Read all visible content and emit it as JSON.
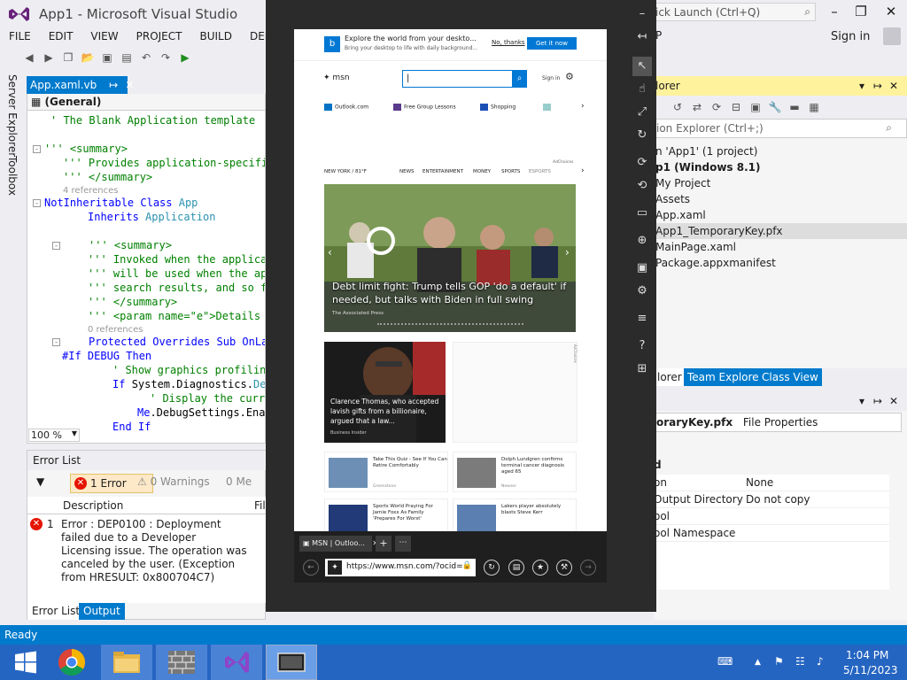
{
  "vs": {
    "title": "App1 - Microsoft Visual Studio",
    "quick_launch": "ick Launch (Ctrl+Q)",
    "sign_in": "Sign in",
    "menu": [
      "FILE",
      "EDIT",
      "VIEW",
      "PROJECT",
      "BUILD",
      "DEBUG"
    ],
    "menu_fragment": "P"
  },
  "side_tabs": [
    "Server Explorer",
    "Toolbox"
  ],
  "editor": {
    "tab_label": "App.xaml.vb",
    "nav": "(General)",
    "zoom": "100 %",
    "lines": [
      "' The Blank Application template",
      "''' <summary>",
      "''' Provides application-specific",
      "''' </summary>",
      "4 references",
      "NotInheritable Class App",
      "Inherits Application",
      "''' <summary>",
      "''' Invoked when the applicat",
      "''' will be used when the app",
      "''' search results, and so fo",
      "''' </summary>",
      "''' <param name=\"e\">Details a",
      "0 references",
      "Protected Overrides Sub OnLau",
      "#If DEBUG Then",
      "' Show graphics profiling",
      "If System.Diagnostics.Deb",
      "' Display the current",
      "Me.DebugSettings.Enab",
      "End If"
    ]
  },
  "error_list": {
    "title": "Error List",
    "errors_btn": "1 Error",
    "warnings_btn": "0 Warnings",
    "messages_btn": "0 Me",
    "col_description": "Description",
    "col_file": "Fil",
    "row_num": "1",
    "row_text": "Error : DEP0100 : Deployment failed due to a Developer Licensing issue. The operation was canceled by the user. (Exception from HRESULT: 0x800704C7)",
    "tab_errors": "Error List",
    "tab_output": "Output"
  },
  "solution": {
    "title": "lorer",
    "search": "ion Explorer (Ctrl+;)",
    "items": [
      "n 'App1' (1 project)",
      "p1 (Windows 8.1)",
      "My Project",
      "Assets",
      "App.xaml",
      "App1_TemporaryKey.pfx",
      "MainPage.xaml",
      "Package.appxmanifest"
    ],
    "tabs": [
      "lorer",
      "Team Explorer",
      "Class View"
    ]
  },
  "properties": {
    "combo_file": "oraryKey.pfx",
    "combo_type": "File Properties",
    "section": "d",
    "rows": [
      {
        "key": "on",
        "value": "None"
      },
      {
        "key": "Output Directory",
        "value": "Do not copy"
      },
      {
        "key": "ool",
        "value": ""
      },
      {
        "key": "ool Namespace",
        "value": ""
      }
    ]
  },
  "status": "Ready",
  "msn": {
    "banner_title": "Explore the world from your deskto...",
    "banner_sub": "Bring your desktop to life with daily background...",
    "not_now": "No, thanks",
    "get_it": "Get it now",
    "logo": "msn",
    "signin": "Sign in",
    "links": [
      "Outlook.com",
      "Free Group Lessons",
      "Shopping"
    ],
    "adchoices": "AdChoices",
    "nav": [
      "NEW YORK / 81°F",
      "NEWS",
      "ENTERTAINMENT",
      "MONEY",
      "SPORTS",
      "ESPORTS"
    ],
    "hero_title": "Debt limit fight: Trump tells GOP 'do a default' if needed, but talks with Biden in full swing",
    "hero_source": "The Associated Press",
    "card1_title": "Clarence Thomas, who accepted lavish gifts from a billionaire, argued that a law...",
    "card1_source": "Business Insider",
    "ad_label": "AdChoices",
    "small": [
      {
        "title": "Take This Quiz - See If You Can Retire Comfortably",
        "source": "Greenstone"
      },
      {
        "title": "Dolph Lundgren confirms terminal cancer diagnosis aged 65",
        "source": "Newser"
      },
      {
        "title": "Sports World Praying For Jamie Foxx As Family 'Prepares For Worst'",
        "source": ""
      },
      {
        "title": "Lakers player absolutely blasts Steve Kerr",
        "source": "The Comeback"
      }
    ]
  },
  "edge": {
    "tab": "MSN | Outloo...",
    "url": "https://www.msn.com/?ocid="
  },
  "clock": {
    "time": "1:04 PM",
    "date": "5/11/2023"
  }
}
